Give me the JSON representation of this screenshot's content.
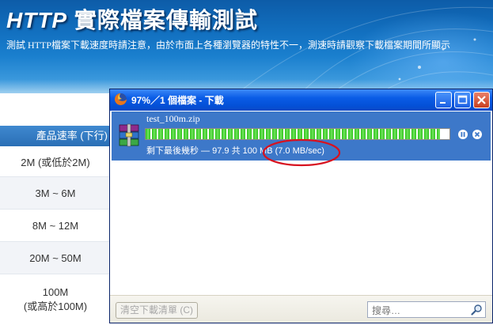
{
  "banner": {
    "title_en": "HTTP",
    "title_zh": "實際檔案傳輸測試",
    "description": "測試 HTTP檔案下載速度時請注意，由於市面上各種瀏覽器的特性不一，測速時請觀察下載檔案期間所顯示"
  },
  "speed_table": {
    "header": "產品速率 (下行)",
    "rows": [
      "2M (或低於2M)",
      "3M ~ 6M",
      "8M ~ 12M",
      "20M ~ 50M",
      "100M",
      "(或高於100M)"
    ]
  },
  "download_window": {
    "title": "97%／1 個檔案 - 下載",
    "item": {
      "filename": "test_100m.zip",
      "progress_percent": 97,
      "status": "剩下最後幾秒 — 97.9 共 100 MB (7.0 MB/sec)"
    },
    "clear_button": "清空下載清單 (C)",
    "search_placeholder": "搜尋…"
  },
  "colors": {
    "banner_blue": "#1270c0",
    "titlebar_blue": "#0451d8",
    "selected_item": "#3d78c9",
    "progress_green": "#2ec31c",
    "annotation_red": "#d7121f"
  }
}
